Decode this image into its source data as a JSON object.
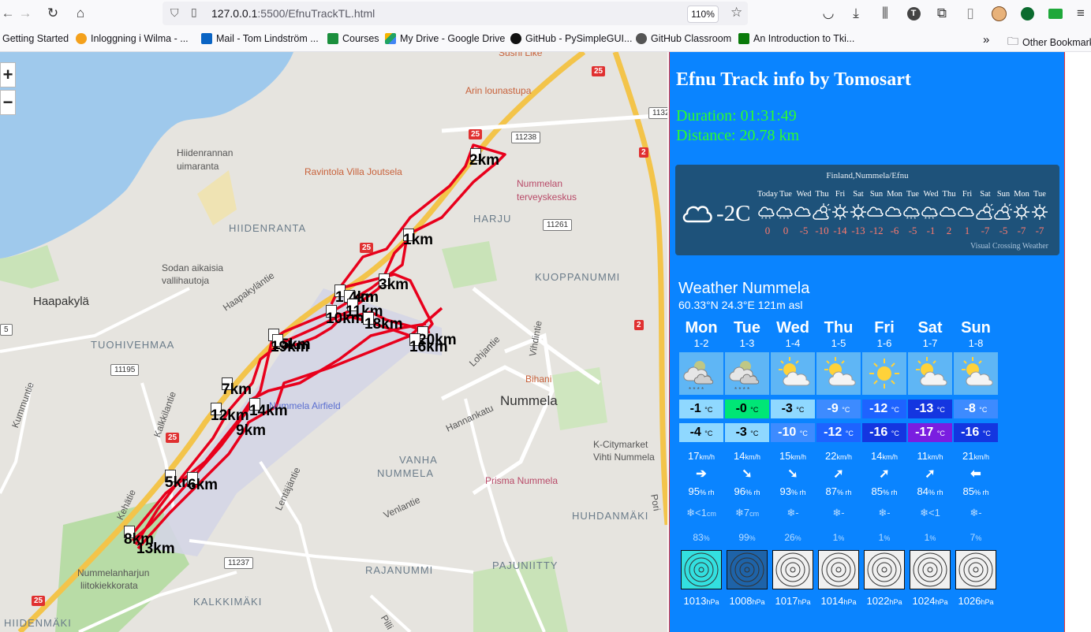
{
  "browser": {
    "url_host": "127.0.0.1",
    "url_path": ":5500/EfnuTrackTL.html",
    "zoom": "110%",
    "bookmarks": [
      "Getting Started",
      "Inloggning i Wilma - ...",
      "Mail - Tom Lindström ...",
      "Courses",
      "My Drive - Google Drive",
      "GitHub - PySimpleGUI...",
      "GitHub Classroom",
      "An Introduction to Tki..."
    ],
    "other_bookmarks": "Other Bookmarks"
  },
  "map": {
    "zoom_in": "+",
    "zoom_out": "−",
    "place_labels": {
      "sushi": "Sushi Like",
      "arin": "Arin lounastupa",
      "hiidenrannan": "Hiidenrannan",
      "uimaranta": "uimaranta",
      "ravintola": "Ravintola Villa Joutsela",
      "nummelan": "Nummelan",
      "terveyskeskus": "terveyskeskus",
      "harju": "HARJU",
      "hiidenranta": "HIIDENRANTA",
      "sodan1": "Sodan aikaisia",
      "sodan2": "vallihautoja",
      "haapakyla": "Haapakylä",
      "haapakylantie": "Haapakyläntie",
      "kuoppanummi": "KUOPPANUMMI",
      "tuohivehmaa": "TUOHIVEHMAA",
      "lohjantie": "Lohjantie",
      "vihdintie": "Vihdintie",
      "bihani": "Bihani",
      "nummela": "Nummela",
      "airfield": "Nummela Airfield",
      "hannankatu": "Hannankatu",
      "kcity1": "K-Citymarket",
      "kcity2": "Vihti Nummela",
      "vanha": "VANHA",
      "nummela_area": "NUMMELA",
      "prisma": "Prisma Nummela",
      "lentajantie": "Lentäjäntie",
      "venlantie": "Venlantie",
      "huhdanmaki": "HUHDANMÄKI",
      "kehatie": "Kehätie",
      "kalkkilantie": "Kalkkilantie",
      "kummuntie": "Kummuntie",
      "nummelanharjun": "Nummelanharjun",
      "liitokiekkorata": "liitokiekkorata",
      "rajanummi": "RAJANUMMI",
      "pajuniitty": "PAJUNIITTY",
      "kalkkimaki": "KALKKIMÄKI",
      "hiidenmaki": "HIIDENMÄKI",
      "pilli": "Pilli",
      "pori": "Pori"
    },
    "road_shields": {
      "r25a": "25",
      "r25b": "25",
      "r25c": "25",
      "r25d": "25",
      "r2a": "2",
      "r2b": "2",
      "r11238": "11238",
      "r11261": "11261",
      "r11195": "11195",
      "r11237": "11237",
      "r1132": "1132",
      "r5": "5"
    },
    "km_labels": {
      "k1": "1km",
      "k2": "2km",
      "k3": "3km",
      "k5": "5km",
      "k6": "6km",
      "k7": "7km",
      "k8": "8km",
      "k9": "9km",
      "k10": "10km",
      "k11": "11km",
      "k12": "12km",
      "k13": "13km",
      "k14": "14km",
      "k16": "16km",
      "k17": "17km",
      "k18": "18km",
      "k19": "19km",
      "k20": "20km",
      "k4": "4km",
      "k15": "15km"
    }
  },
  "panel": {
    "title": "Efnu Track info by Tomosart",
    "duration": "Duration: 01:31:49",
    "distance": "Distance: 20.78 km"
  },
  "widget": {
    "location": "Finland,Nummela/Efnu",
    "current_temp": "-2C",
    "credit": "Visual Crossing Weather",
    "days": [
      "Today",
      "Tue",
      "Wed",
      "Thu",
      "Fri",
      "Sat",
      "Sun",
      "Mon",
      "Tue",
      "Wed",
      "Thu",
      "Fri",
      "Sat",
      "Sun",
      "Mon",
      "Tue"
    ],
    "temps": [
      "0",
      "0",
      "-5",
      "-10",
      "-14",
      "-13",
      "-12",
      "-6",
      "-5",
      "-1",
      "2",
      "1",
      "-7",
      "-5",
      "-7",
      "-7"
    ]
  },
  "forecast": {
    "title": "Weather Nummela",
    "coords": "60.33°N 24.3°E 121m asl",
    "temp_unit": "°C",
    "wind_unit": "km/h",
    "rh_unit": "% rh",
    "pres_unit": "hPa",
    "days": [
      {
        "name": "Mon",
        "date": "1-2",
        "max": "-1",
        "min": "-4",
        "wind": "17",
        "arrow": "➔",
        "rh": "95",
        "snow": "❄<1",
        "snow_unit": "cm",
        "prob": "83",
        "pres": "1013"
      },
      {
        "name": "Tue",
        "date": "1-3",
        "max": "-0",
        "min": "-3",
        "wind": "14",
        "arrow": "➘",
        "rh": "96",
        "snow": "❄7",
        "snow_unit": "cm",
        "prob": "99",
        "pres": "1008"
      },
      {
        "name": "Wed",
        "date": "1-4",
        "max": "-3",
        "min": "-10",
        "wind": "15",
        "arrow": "➘",
        "rh": "93",
        "snow": "❄-",
        "snow_unit": "",
        "prob": "26",
        "pres": "1017"
      },
      {
        "name": "Thu",
        "date": "1-5",
        "max": "-9",
        "min": "-12",
        "wind": "22",
        "arrow": "➚",
        "rh": "87",
        "snow": "❄-",
        "snow_unit": "",
        "prob": "1",
        "pres": "1014"
      },
      {
        "name": "Fri",
        "date": "1-6",
        "max": "-12",
        "min": "-16",
        "wind": "14",
        "arrow": "➚",
        "rh": "85",
        "snow": "❄-",
        "snow_unit": "",
        "prob": "1",
        "pres": "1022"
      },
      {
        "name": "Sat",
        "date": "1-7",
        "max": "-13",
        "min": "-17",
        "wind": "11",
        "arrow": "➚",
        "rh": "84",
        "snow": "❄<1",
        "snow_unit": "",
        "prob": "1",
        "pres": "1024"
      },
      {
        "name": "Sun",
        "date": "1-8",
        "max": "-8",
        "min": "-16",
        "wind": "21",
        "arrow": "⬅",
        "rh": "85",
        "snow": "❄-",
        "snow_unit": "",
        "prob": "7",
        "pres": "1026"
      }
    ],
    "prob_unit": "%"
  },
  "colors": {
    "panel_bg": "#0a84ff",
    "stats": "#2cff2c",
    "track": "#e8001c",
    "widget_bg": "#1e527a"
  }
}
